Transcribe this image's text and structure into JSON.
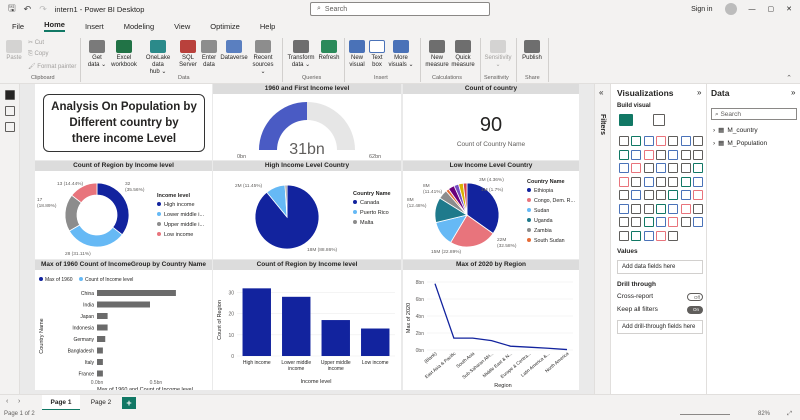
{
  "app": {
    "filename": "intern1",
    "app_name": "Power BI Desktop",
    "search_placeholder": "Search",
    "signin_label": "Sign in"
  },
  "menu": [
    "File",
    "Home",
    "Insert",
    "Modeling",
    "View",
    "Optimize",
    "Help"
  ],
  "ribbon": {
    "clipboard": {
      "paste": "Paste",
      "cut": "Cut",
      "copy": "Copy",
      "format_painter": "Format painter",
      "group": "Clipboard"
    },
    "data": {
      "get_data": [
        "Get",
        "data ⌄"
      ],
      "excel": [
        "Excel",
        "workbook"
      ],
      "onelake": [
        "OneLake data",
        "hub ⌄"
      ],
      "sql": [
        "SQL",
        "Server"
      ],
      "enter": [
        "Enter",
        "data"
      ],
      "dataverse": [
        "Dataverse"
      ],
      "recent": [
        "Recent",
        "sources ⌄"
      ],
      "group": "Data"
    },
    "queries": {
      "transform": [
        "Transform",
        "data ⌄"
      ],
      "refresh": [
        "Refresh"
      ],
      "group": "Queries"
    },
    "insert": {
      "new_visual": [
        "New",
        "visual"
      ],
      "text_box": [
        "Text",
        "box"
      ],
      "more": [
        "More",
        "visuals ⌄"
      ],
      "group": "Insert"
    },
    "calculations": {
      "new_measure": [
        "New",
        "measure"
      ],
      "quick": [
        "Quick",
        "measure"
      ],
      "group": "Calculations"
    },
    "sensitivity": {
      "label": [
        "Sensitivity",
        "⌄"
      ],
      "group": "Sensitivity"
    },
    "share": {
      "publish": [
        "Publish"
      ],
      "group": "Share"
    }
  },
  "colors": {
    "accent": "#117865",
    "navy": "#12239e",
    "gauge": "#4a5bc4",
    "donut_pink": "#e8747c",
    "donut_lightblue": "#66b9f5",
    "donut_gray": "#8c8c8c"
  },
  "title_card": [
    "Analysis On Population by",
    "Different country by",
    "there income Level"
  ],
  "gauge": {
    "title": "1960 and First Income level",
    "value": "31bn",
    "min": "0bn",
    "max": "62bn",
    "fraction": 0.5
  },
  "card": {
    "title": "Count of country",
    "value": "90",
    "label": "Count of Country Name"
  },
  "visual_titles": {
    "donut_region": "Count of Region by Income level",
    "pie_high": "High Income Level Country",
    "pie_low": "Low Income Level Country",
    "bar_1960": "Max of 1960 Count of IncomeGroup by Country Name",
    "col_region": "Count of Region by Income level",
    "line_2020": "Max of 2020 by Region"
  },
  "chart_data": [
    {
      "type": "pie",
      "id": "donut_region",
      "title": "Count of Region by Income level",
      "legend_title": "Income level",
      "legend_position": "right",
      "categories": [
        "High income",
        "Lower middle i...",
        "Upper middle i...",
        "Low income"
      ],
      "values": [
        32,
        28,
        17,
        13
      ],
      "data_labels": [
        "32\n(35.56%)",
        "28 (31.11%)",
        "17\n(18.89%)",
        "13 (14.44%)"
      ],
      "colors": [
        "#12239e",
        "#66b9f5",
        "#8c8c8c",
        "#e8747c"
      ]
    },
    {
      "type": "pie",
      "id": "pie_high",
      "title": "High Income Level Country",
      "legend_title": "Country Name",
      "legend_position": "right",
      "categories": [
        "Canada",
        "Puerto Rico",
        "Malta"
      ],
      "values": [
        18,
        2,
        0.2
      ],
      "data_labels": [
        "18M (88.86%)",
        "2M (11.45%)"
      ],
      "colors": [
        "#12239e",
        "#66b9f5",
        "#8c8c8c"
      ]
    },
    {
      "type": "pie",
      "id": "pie_low",
      "title": "Low Income Level Country",
      "legend_title": "Country Name",
      "legend_position": "right",
      "categories": [
        "Ethiopia",
        "Congo, Dem. R...",
        "Sudan",
        "Uganda",
        "Zambia",
        "South Sudan"
      ],
      "values": [
        22,
        15,
        8,
        8,
        3,
        1
      ],
      "data_labels": [
        "22M\n(32.58%)",
        "15M (22.89%)",
        "8M\n(12.48%)",
        "8M\n(11.41%)",
        "3M (4.36%)",
        "1M (1.7%)"
      ],
      "colors": [
        "#12239e",
        "#e8747c",
        "#66b9f5",
        "#1f7a8c",
        "#8c8c8c",
        "#e66c37",
        "#6b007b",
        "#744ec2",
        "#d9b300",
        "#d64550"
      ]
    },
    {
      "type": "bar",
      "id": "bar_1960",
      "orientation": "horizontal",
      "title": "Max of 1960 Count of IncomeGroup by Country Name",
      "legend": [
        "Max of 1960",
        "Count of Income level"
      ],
      "legend_position": "top-left",
      "xlabel": "Max of 1960 and Count of Income level",
      "ylabel": "Country Name",
      "categories": [
        "China",
        "India",
        "Japan",
        "Indonesia",
        "Germany",
        "Bangladesh",
        "Italy",
        "France"
      ],
      "values": [
        0.67,
        0.45,
        0.09,
        0.09,
        0.07,
        0.05,
        0.05,
        0.05
      ],
      "x_ticks": [
        "0.0bn",
        "0.5bn"
      ],
      "xlim": [
        0,
        0.9
      ]
    },
    {
      "type": "bar",
      "id": "col_region",
      "title": "Count of Region by Income level",
      "xlabel": "Income level",
      "ylabel": "Count of Region",
      "categories": [
        "High income",
        "Lower middle income",
        "Upper middle income",
        "Low income"
      ],
      "values": [
        32,
        28,
        17,
        13
      ],
      "y_ticks": [
        0,
        10,
        20,
        30
      ],
      "ylim": [
        0,
        35
      ]
    },
    {
      "type": "line",
      "id": "line_2020",
      "title": "Max of 2020 by Region",
      "xlabel": "Region",
      "ylabel": "Max of 2020",
      "categories": [
        "(Blank)",
        "East Asia & Pacific",
        "South Asia",
        "Sub-Saharan Afri...",
        "Middle East & N...",
        "Europe & Centra...",
        "Latin America &...",
        "North America"
      ],
      "values": [
        7.8,
        1.4,
        1.4,
        1.1,
        0.45,
        0.33,
        0.21,
        0.05
      ],
      "y_ticks": [
        "0bn",
        "2bn",
        "4bn",
        "6bn",
        "8bn"
      ],
      "ylim": [
        0,
        8
      ]
    }
  ],
  "filters_pane": {
    "label": "Filters"
  },
  "viz_pane": {
    "title": "Visualizations",
    "build_visual": "Build visual",
    "values": "Values",
    "add_data": "Add data fields here",
    "drill_through": "Drill through",
    "cross_report": "Cross-report",
    "cross_report_state": "Off",
    "keep_filters": "Keep all filters",
    "keep_filters_state": "On",
    "add_drill": "Add drill-through fields here"
  },
  "data_pane": {
    "title": "Data",
    "search_placeholder": "Search",
    "tables": [
      "M_country",
      "M_Population"
    ]
  },
  "pages": [
    "Page 1",
    "Page 2"
  ],
  "status": {
    "page": "Page 1 of 2",
    "zoom": "82%"
  }
}
